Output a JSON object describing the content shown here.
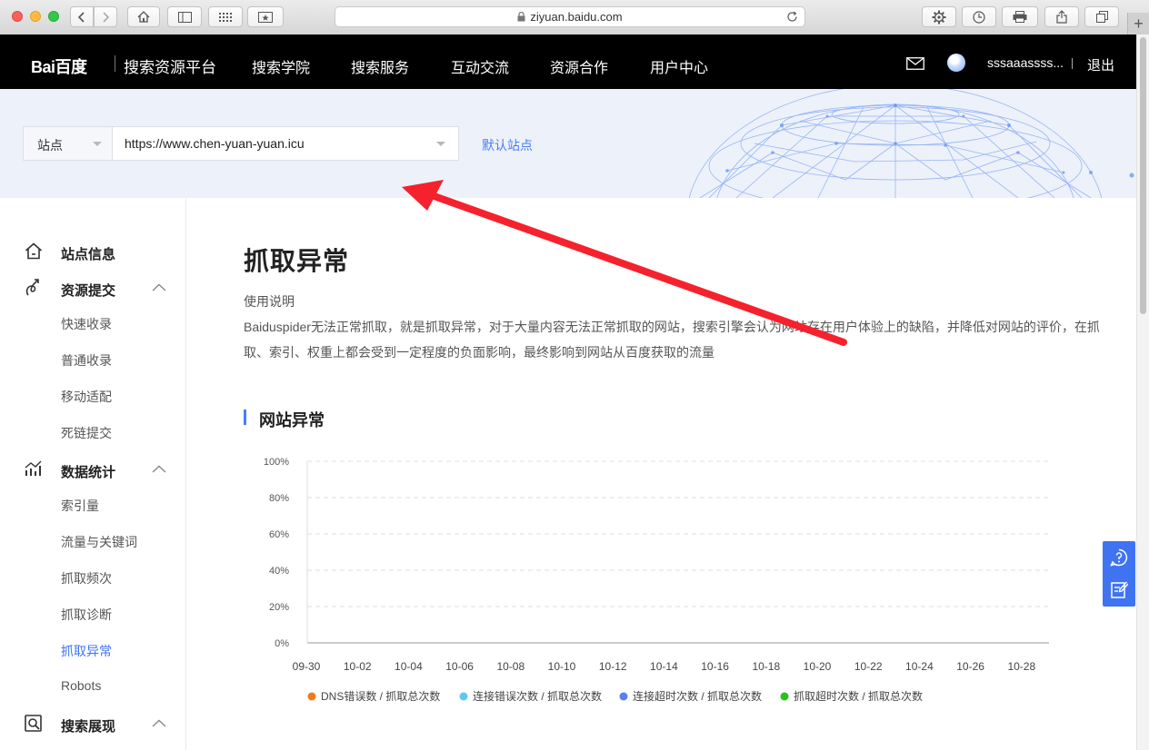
{
  "browser": {
    "url": "ziyuan.baidu.com",
    "icons": [
      "back-icon",
      "forward-icon",
      "home-icon",
      "sidebar-icon",
      "grid-icon",
      "bookmark-icon",
      "gear-icon",
      "history-icon",
      "print-icon",
      "share-icon",
      "tabs-icon",
      "reload-icon",
      "lock-icon"
    ]
  },
  "topnav": {
    "logo": "Bai百度",
    "platform": "搜索资源平台",
    "items": [
      "搜索学院",
      "搜索服务",
      "互动交流",
      "资源合作",
      "用户中心"
    ],
    "username": "sssaaassss...",
    "logout": "退出"
  },
  "site_band": {
    "site_label": "站点",
    "site_url": "https://www.chen-yuan-yuan.icu",
    "default_site": "默认站点"
  },
  "sidebar": {
    "groups": [
      {
        "label": "站点信息",
        "icon": "home-icon"
      },
      {
        "label": "资源提交",
        "icon": "submit-icon",
        "items": [
          "快速收录",
          "普通收录",
          "移动适配",
          "死链提交"
        ]
      },
      {
        "label": "数据统计",
        "icon": "stats-icon",
        "items": [
          "索引量",
          "流量与关键词",
          "抓取频次",
          "抓取诊断",
          "抓取异常",
          "Robots"
        ]
      },
      {
        "label": "搜索展现",
        "icon": "search-display-icon"
      }
    ],
    "active_item": "抓取异常"
  },
  "main": {
    "title": "抓取异常",
    "usage_title": "使用说明",
    "usage_text": "Baiduspider无法正常抓取，就是抓取异常，对于大量内容无法正常抓取的网站，搜索引擎会认为网站存在用户体验上的缺陷，并降低对网站的评价，在抓取、索引、权重上都会受到一定程度的负面影响，最终影响到网站从百度获取的流量",
    "section_title": "网站异常"
  },
  "chart_data": {
    "type": "line",
    "x": [
      "09-30",
      "10-02",
      "10-04",
      "10-06",
      "10-08",
      "10-10",
      "10-12",
      "10-14",
      "10-16",
      "10-18",
      "10-20",
      "10-22",
      "10-24",
      "10-26",
      "10-28"
    ],
    "y_ticks": [
      "100%",
      "80%",
      "60%",
      "40%",
      "20%",
      "0%"
    ],
    "ylim": [
      0,
      100
    ],
    "grid": true,
    "legend_position": "bottom",
    "series": [
      {
        "name": "DNS错误数 / 抓取总次数",
        "color": "#f27a1a",
        "values": []
      },
      {
        "name": "连接错误次数 / 抓取总次数",
        "color": "#5ec8f5",
        "values": []
      },
      {
        "name": "连接超时次数 / 抓取总次数",
        "color": "#5b7ff0",
        "values": []
      },
      {
        "name": "抓取超时次数 / 抓取总次数",
        "color": "#27c21d",
        "values": []
      }
    ]
  },
  "colors": {
    "accent": "#3f73f2",
    "nav_bg": "#000000",
    "annotation_arrow": "#f5222d"
  }
}
